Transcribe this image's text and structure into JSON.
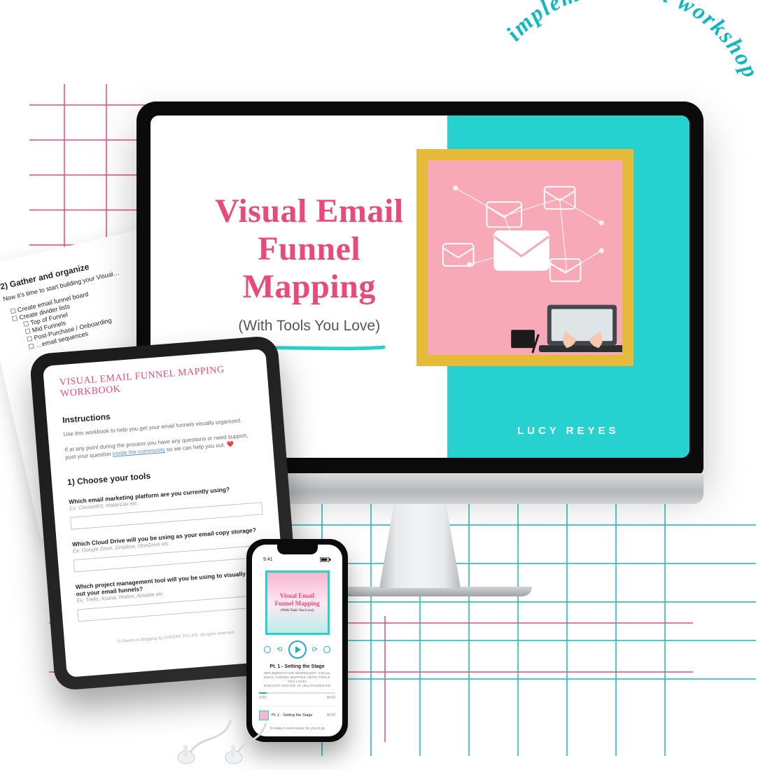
{
  "curved_label": "implementation workshop",
  "monitor": {
    "title_line1": "Visual Email",
    "title_line2": "Funnel Mapping",
    "subtitle": "(With Tools You Love)",
    "author": "LUCY REYES"
  },
  "sheet": {
    "heading": "2) Gather and organize",
    "lead": "Now it's time to start building your Visual…",
    "items": [
      "Create email funnel board",
      "Create divider lists",
      "Top of Funnel",
      "Mid Funnels",
      "Post-Purchase / Onboarding",
      "…email sequences"
    ]
  },
  "tablet": {
    "doc_title": "VISUAL EMAIL FUNNEL MAPPING WORKBOOK",
    "h_instructions": "Instructions",
    "p_instructions": "Use this workbook to help you get your email funnels visually organized.",
    "note_pre": "If at any point during the process you have any questions or need support, post your question ",
    "note_link": "inside the community",
    "note_post": " so we can help you out. ❤️",
    "h_choose": "1) Choose your tools",
    "q1": "Which email marketing platform are you currently using?",
    "q1_hint": "Ex: ConvertKit, MailerLite etc.",
    "q2": "Which Cloud Drive will you be using as your email copy storage?",
    "q2_hint": "Ex: Google Drive, Dropbox, OneDrive etc.",
    "q3": "Which project management tool will you be using to visually map out your email funnels?",
    "q3_hint": "Ex: Trello, Asana, Notion, Airtable etc.",
    "footer": "© Cheers to Blogging by CHEERS TO LIFE. All rights reserved."
  },
  "phone": {
    "time": "9:41",
    "cover_title1": "Visual Email",
    "cover_title2": "Funnel Mapping",
    "cover_sub": "(With Tools You Love)",
    "track": "Pt. 1 - Setting the Stage",
    "meta1": "IMPLEMENTATION WORKSHOP: VISUAL",
    "meta2": "EMAIL FUNNEL MAPPING (WITH TOOLS",
    "meta3": "YOU LOVE)",
    "meta4": "PODCAST HOSTED AT HELLOAUDIO.FM",
    "t_start": "0:03",
    "t_end": "30:42",
    "row_label": "Pt. 1 - Setting the Stage",
    "row_len": "30:42",
    "foot": "To make it even easier for you to go"
  }
}
